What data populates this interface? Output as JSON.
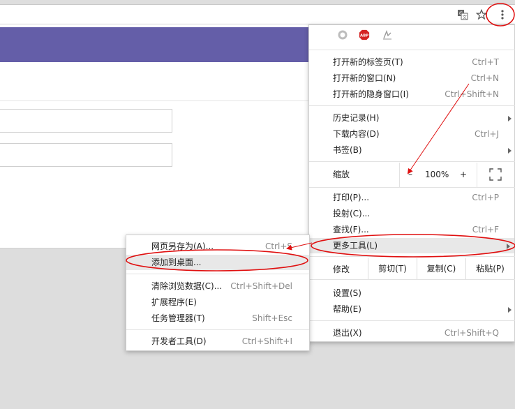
{
  "colors": {
    "page_header": "#645ea8",
    "annotation": "#e01010"
  },
  "toolbar": {
    "icons": [
      "translate-icon",
      "star-icon",
      "kebab-menu-icon"
    ]
  },
  "extensions": [
    {
      "name": "circle-extension-icon",
      "label": ""
    },
    {
      "name": "abp-icon",
      "label": "ABP"
    },
    {
      "name": "script-extension-icon",
      "label": ""
    }
  ],
  "main_menu": {
    "group1": [
      {
        "label": "打开新的标签页(T)",
        "shortcut": "Ctrl+T"
      },
      {
        "label": "打开新的窗口(N)",
        "shortcut": "Ctrl+N"
      },
      {
        "label": "打开新的隐身窗口(I)",
        "shortcut": "Ctrl+Shift+N"
      }
    ],
    "group2": [
      {
        "label": "历史记录(H)",
        "shortcut": "",
        "submenu": true
      },
      {
        "label": "下载内容(D)",
        "shortcut": "Ctrl+J",
        "submenu": false
      },
      {
        "label": "书签(B)",
        "shortcut": "",
        "submenu": true
      }
    ],
    "zoom": {
      "label": "缩放",
      "minus": "–",
      "value": "100%",
      "plus": "+"
    },
    "group3": [
      {
        "label": "打印(P)...",
        "shortcut": "Ctrl+P"
      },
      {
        "label": "投射(C)...",
        "shortcut": ""
      },
      {
        "label": "查找(F)...",
        "shortcut": "Ctrl+F"
      }
    ],
    "more_tools": {
      "label": "更多工具(L)"
    },
    "edit": {
      "label": "修改",
      "cut": "剪切(T)",
      "copy": "复制(C)",
      "paste": "粘贴(P)"
    },
    "group4": [
      {
        "label": "设置(S)",
        "shortcut": "",
        "submenu": false
      },
      {
        "label": "帮助(E)",
        "shortcut": "",
        "submenu": true
      }
    ],
    "exit": {
      "label": "退出(X)",
      "shortcut": "Ctrl+Shift+Q"
    }
  },
  "submenu": {
    "group1": [
      {
        "label": "网页另存为(A)...",
        "shortcut": "Ctrl+S"
      },
      {
        "label": "添加到桌面...",
        "shortcut": ""
      }
    ],
    "group2": [
      {
        "label": "清除浏览数据(C)...",
        "shortcut": "Ctrl+Shift+Del"
      },
      {
        "label": "扩展程序(E)",
        "shortcut": ""
      },
      {
        "label": "任务管理器(T)",
        "shortcut": "Shift+Esc"
      }
    ],
    "group3": [
      {
        "label": "开发者工具(D)",
        "shortcut": "Ctrl+Shift+I"
      }
    ]
  }
}
